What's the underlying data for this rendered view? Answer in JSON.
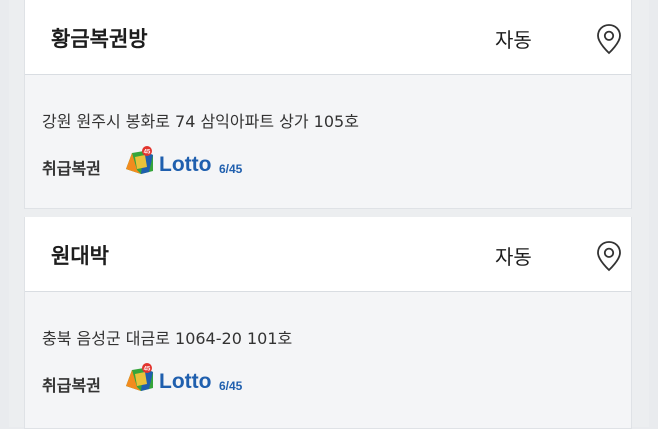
{
  "stores": [
    {
      "name": "황금복권방",
      "mode": "자동",
      "address": "강원 원주시 봉화로 74 삼익아파트 상가 105호",
      "handles_label": "취급복권",
      "lotto_brand": "Lotto",
      "lotto_sub": "6/45"
    },
    {
      "name": "원대박",
      "mode": "자동",
      "address": "충북 음성군 대금로 1064-20 101호",
      "handles_label": "취급복권",
      "lotto_brand": "Lotto",
      "lotto_sub": "6/45"
    }
  ],
  "icons": {
    "location": "map-pin-icon",
    "lotto_logo": "lotto-ball-icon"
  },
  "colors": {
    "lotto_blue": "#1f5fae",
    "lotto_green": "#35a53a",
    "lotto_orange": "#f28b1e"
  }
}
